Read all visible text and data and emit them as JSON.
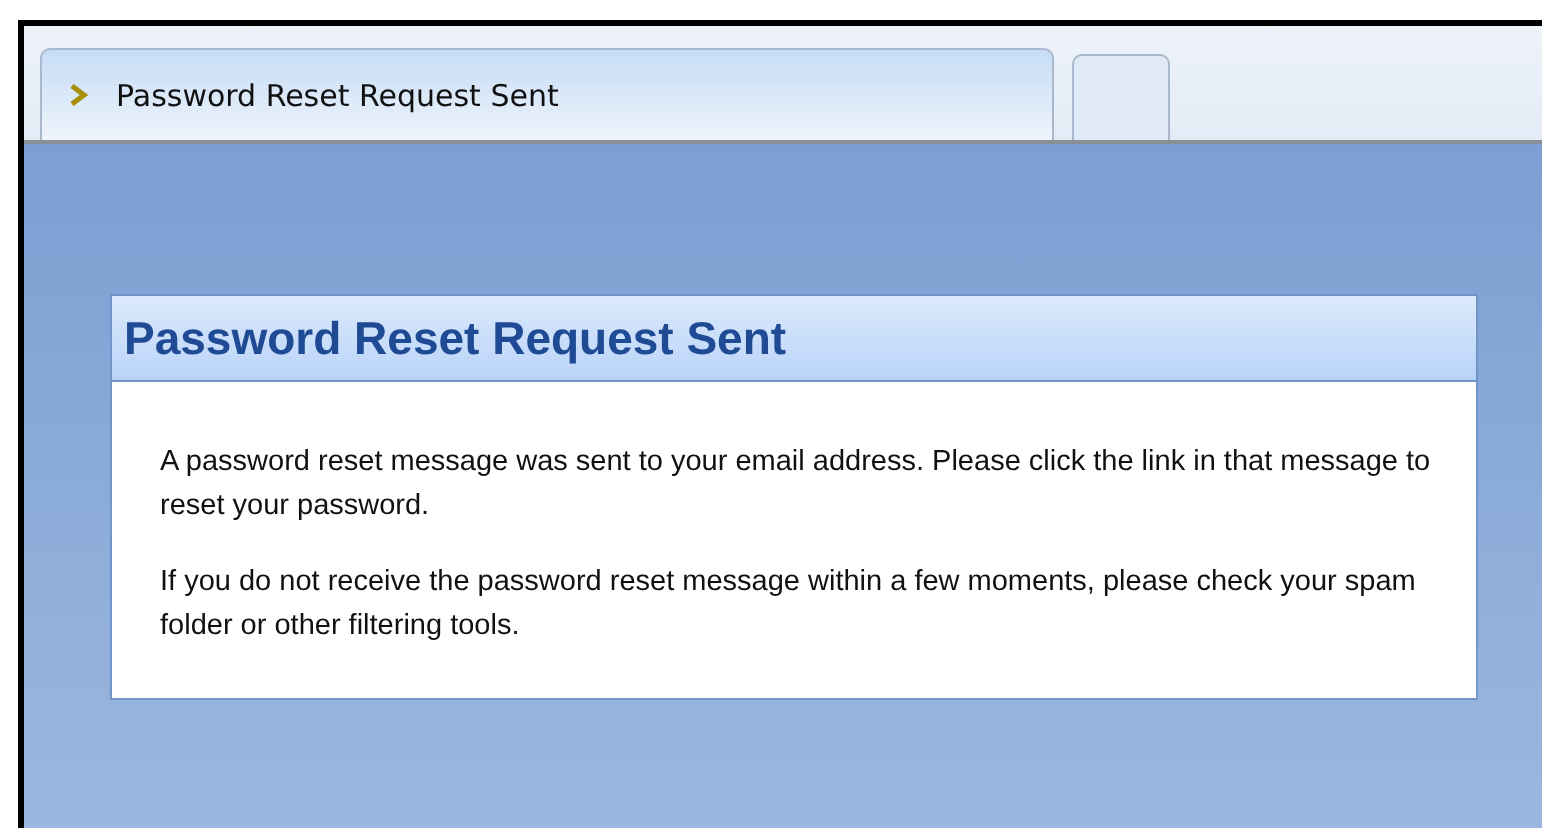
{
  "tabs": [
    {
      "kind": "page",
      "label": "Password Reset Request Sent",
      "selected": true
    },
    {
      "kind": "blank",
      "selected": false
    }
  ],
  "card": {
    "title": "Password Reset Request Sent",
    "paragraphs": [
      "A password reset message was sent to your email address. Please click the link in that message to reset your password.",
      "If you do not receive the password reset message within a few moments, please check your spam folder or other filtering tools."
    ]
  }
}
